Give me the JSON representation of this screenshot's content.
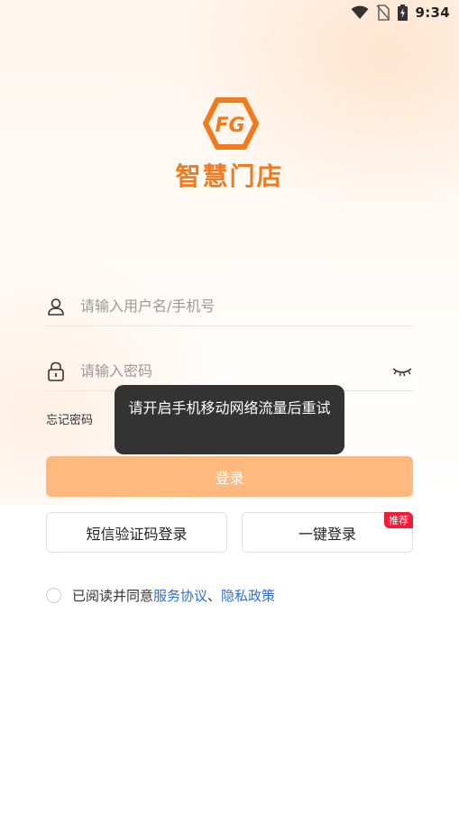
{
  "status_bar": {
    "time": "9:34",
    "icons": [
      "wifi-icon",
      "no-sim-icon",
      "battery-charging-icon"
    ]
  },
  "brand": {
    "logo_icon": "fg-hexagon-logo-icon",
    "logo_text": "FG",
    "app_name": "智慧门店",
    "brand_color": "#f07a1d"
  },
  "form": {
    "username_placeholder": "请输入用户名/手机号",
    "password_placeholder": "请输入密码",
    "username_icon": "user-icon",
    "password_icon": "lock-icon",
    "toggle_icon": "eye-closed-icon",
    "forgot_label": "忘记密码",
    "login_label": "登录",
    "login_color": "#ffb97e"
  },
  "alt_login": {
    "sms_label": "短信验证码登录",
    "onekey_label": "一键登录",
    "recommend_badge": "推荐"
  },
  "agreement": {
    "prefix": "已阅读并同意 ",
    "service_link": "服务协议",
    "separator": "、",
    "privacy_link": "隐私政策",
    "link_color": "#2f6ed7"
  },
  "toast": {
    "message": "请开启手机移动网络流量后重试"
  }
}
